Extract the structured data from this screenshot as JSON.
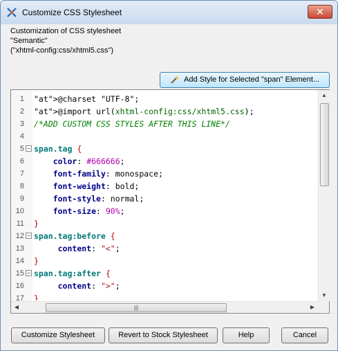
{
  "window": {
    "title": "Customize CSS Stylesheet",
    "close_glyph": "✕"
  },
  "description": {
    "line1": "Customization of CSS stylesheet",
    "line2": "\"Semantic\"",
    "line3": "(\"xhtml-config:css/xhtml5.css\")"
  },
  "add_style_button": {
    "label": "Add Style for Selected \"span\" Element...",
    "icon": "magic-wand-icon"
  },
  "editor": {
    "lines": [
      {
        "num": "1",
        "code": "@charset \"UTF-8\";"
      },
      {
        "num": "2",
        "code": "@import url(xhtml-config:css/xhtml5.css);"
      },
      {
        "num": "3",
        "code": "/*ADD CUSTOM CSS STYLES AFTER THIS LINE*/"
      },
      {
        "num": "4",
        "code": ""
      },
      {
        "num": "5",
        "code": "span.tag {"
      },
      {
        "num": "6",
        "code": "    color: #666666;"
      },
      {
        "num": "7",
        "code": "    font-family: monospace;"
      },
      {
        "num": "8",
        "code": "    font-weight: bold;"
      },
      {
        "num": "9",
        "code": "    font-style: normal;"
      },
      {
        "num": "10",
        "code": "    font-size: 90%;"
      },
      {
        "num": "11",
        "code": "}"
      },
      {
        "num": "12",
        "code": "span.tag:before {"
      },
      {
        "num": "13",
        "code": "     content: \"<\";"
      },
      {
        "num": "14",
        "code": "}"
      },
      {
        "num": "15",
        "code": "span.tag:after {"
      },
      {
        "num": "16",
        "code": "     content: \">\";"
      },
      {
        "num": "17",
        "code": "}"
      }
    ]
  },
  "buttons": {
    "customize": "Customize Stylesheet",
    "revert": "Revert to Stock Stylesheet",
    "help": "Help",
    "cancel": "Cancel"
  },
  "colors": {
    "title_bar": "#c9daef",
    "close_button": "#c74a34",
    "selector": "#007878",
    "property": "#00008b",
    "comment": "#008000",
    "brace": "#c00000"
  }
}
